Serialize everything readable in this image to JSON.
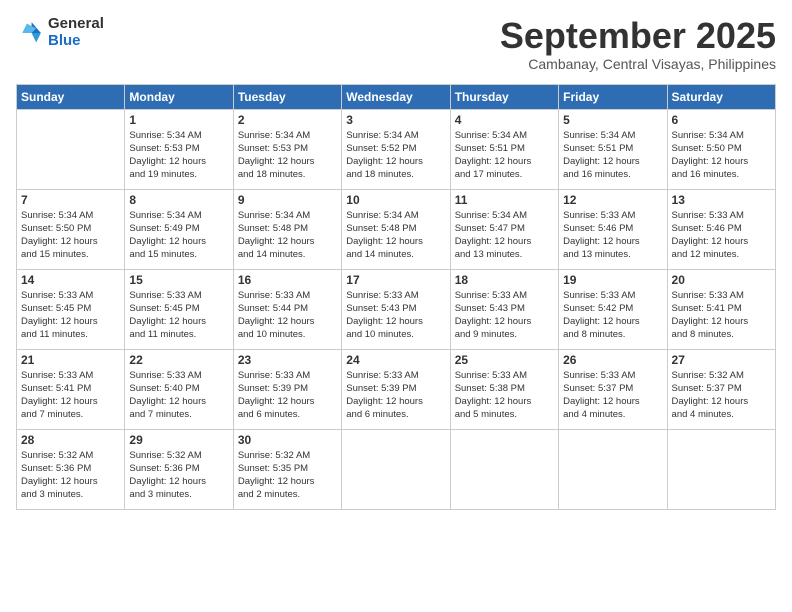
{
  "logo": {
    "general": "General",
    "blue": "Blue",
    "icon": "▶"
  },
  "title": {
    "month": "September 2025",
    "location": "Cambanay, Central Visayas, Philippines"
  },
  "weekdays": [
    "Sunday",
    "Monday",
    "Tuesday",
    "Wednesday",
    "Thursday",
    "Friday",
    "Saturday"
  ],
  "weeks": [
    [
      {
        "day": "",
        "info": ""
      },
      {
        "day": "1",
        "info": "Sunrise: 5:34 AM\nSunset: 5:53 PM\nDaylight: 12 hours\nand 19 minutes."
      },
      {
        "day": "2",
        "info": "Sunrise: 5:34 AM\nSunset: 5:53 PM\nDaylight: 12 hours\nand 18 minutes."
      },
      {
        "day": "3",
        "info": "Sunrise: 5:34 AM\nSunset: 5:52 PM\nDaylight: 12 hours\nand 18 minutes."
      },
      {
        "day": "4",
        "info": "Sunrise: 5:34 AM\nSunset: 5:51 PM\nDaylight: 12 hours\nand 17 minutes."
      },
      {
        "day": "5",
        "info": "Sunrise: 5:34 AM\nSunset: 5:51 PM\nDaylight: 12 hours\nand 16 minutes."
      },
      {
        "day": "6",
        "info": "Sunrise: 5:34 AM\nSunset: 5:50 PM\nDaylight: 12 hours\nand 16 minutes."
      }
    ],
    [
      {
        "day": "7",
        "info": "Sunrise: 5:34 AM\nSunset: 5:50 PM\nDaylight: 12 hours\nand 15 minutes."
      },
      {
        "day": "8",
        "info": "Sunrise: 5:34 AM\nSunset: 5:49 PM\nDaylight: 12 hours\nand 15 minutes."
      },
      {
        "day": "9",
        "info": "Sunrise: 5:34 AM\nSunset: 5:48 PM\nDaylight: 12 hours\nand 14 minutes."
      },
      {
        "day": "10",
        "info": "Sunrise: 5:34 AM\nSunset: 5:48 PM\nDaylight: 12 hours\nand 14 minutes."
      },
      {
        "day": "11",
        "info": "Sunrise: 5:34 AM\nSunset: 5:47 PM\nDaylight: 12 hours\nand 13 minutes."
      },
      {
        "day": "12",
        "info": "Sunrise: 5:33 AM\nSunset: 5:46 PM\nDaylight: 12 hours\nand 13 minutes."
      },
      {
        "day": "13",
        "info": "Sunrise: 5:33 AM\nSunset: 5:46 PM\nDaylight: 12 hours\nand 12 minutes."
      }
    ],
    [
      {
        "day": "14",
        "info": "Sunrise: 5:33 AM\nSunset: 5:45 PM\nDaylight: 12 hours\nand 11 minutes."
      },
      {
        "day": "15",
        "info": "Sunrise: 5:33 AM\nSunset: 5:45 PM\nDaylight: 12 hours\nand 11 minutes."
      },
      {
        "day": "16",
        "info": "Sunrise: 5:33 AM\nSunset: 5:44 PM\nDaylight: 12 hours\nand 10 minutes."
      },
      {
        "day": "17",
        "info": "Sunrise: 5:33 AM\nSunset: 5:43 PM\nDaylight: 12 hours\nand 10 minutes."
      },
      {
        "day": "18",
        "info": "Sunrise: 5:33 AM\nSunset: 5:43 PM\nDaylight: 12 hours\nand 9 minutes."
      },
      {
        "day": "19",
        "info": "Sunrise: 5:33 AM\nSunset: 5:42 PM\nDaylight: 12 hours\nand 8 minutes."
      },
      {
        "day": "20",
        "info": "Sunrise: 5:33 AM\nSunset: 5:41 PM\nDaylight: 12 hours\nand 8 minutes."
      }
    ],
    [
      {
        "day": "21",
        "info": "Sunrise: 5:33 AM\nSunset: 5:41 PM\nDaylight: 12 hours\nand 7 minutes."
      },
      {
        "day": "22",
        "info": "Sunrise: 5:33 AM\nSunset: 5:40 PM\nDaylight: 12 hours\nand 7 minutes."
      },
      {
        "day": "23",
        "info": "Sunrise: 5:33 AM\nSunset: 5:39 PM\nDaylight: 12 hours\nand 6 minutes."
      },
      {
        "day": "24",
        "info": "Sunrise: 5:33 AM\nSunset: 5:39 PM\nDaylight: 12 hours\nand 6 minutes."
      },
      {
        "day": "25",
        "info": "Sunrise: 5:33 AM\nSunset: 5:38 PM\nDaylight: 12 hours\nand 5 minutes."
      },
      {
        "day": "26",
        "info": "Sunrise: 5:33 AM\nSunset: 5:37 PM\nDaylight: 12 hours\nand 4 minutes."
      },
      {
        "day": "27",
        "info": "Sunrise: 5:32 AM\nSunset: 5:37 PM\nDaylight: 12 hours\nand 4 minutes."
      }
    ],
    [
      {
        "day": "28",
        "info": "Sunrise: 5:32 AM\nSunset: 5:36 PM\nDaylight: 12 hours\nand 3 minutes."
      },
      {
        "day": "29",
        "info": "Sunrise: 5:32 AM\nSunset: 5:36 PM\nDaylight: 12 hours\nand 3 minutes."
      },
      {
        "day": "30",
        "info": "Sunrise: 5:32 AM\nSunset: 5:35 PM\nDaylight: 12 hours\nand 2 minutes."
      },
      {
        "day": "",
        "info": ""
      },
      {
        "day": "",
        "info": ""
      },
      {
        "day": "",
        "info": ""
      },
      {
        "day": "",
        "info": ""
      }
    ]
  ]
}
